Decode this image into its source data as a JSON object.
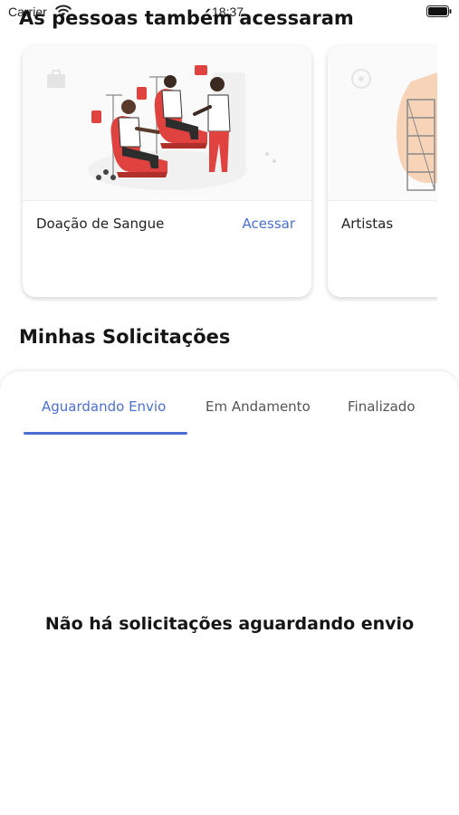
{
  "status_bar": {
    "carrier": "Carrier",
    "time": "18:37"
  },
  "people_also_accessed": {
    "title": "As pessoas também acessaram",
    "cards": [
      {
        "title": "Doação de Sangue",
        "action_label": "Acessar",
        "image_icon": "blood-donation-illustration"
      },
      {
        "title": "Artistas",
        "image_icon": "artists-illustration"
      }
    ]
  },
  "my_requests": {
    "title": "Minhas Solicitações",
    "tabs": [
      {
        "label": "Aguardando Envio",
        "active": true
      },
      {
        "label": "Em Andamento",
        "active": false
      },
      {
        "label": "Finalizado",
        "active": false
      }
    ],
    "empty_message": "Não há solicitações aguardando envio"
  },
  "colors": {
    "accent": "#4a6fd0",
    "illustration_red": "#e0433f"
  }
}
